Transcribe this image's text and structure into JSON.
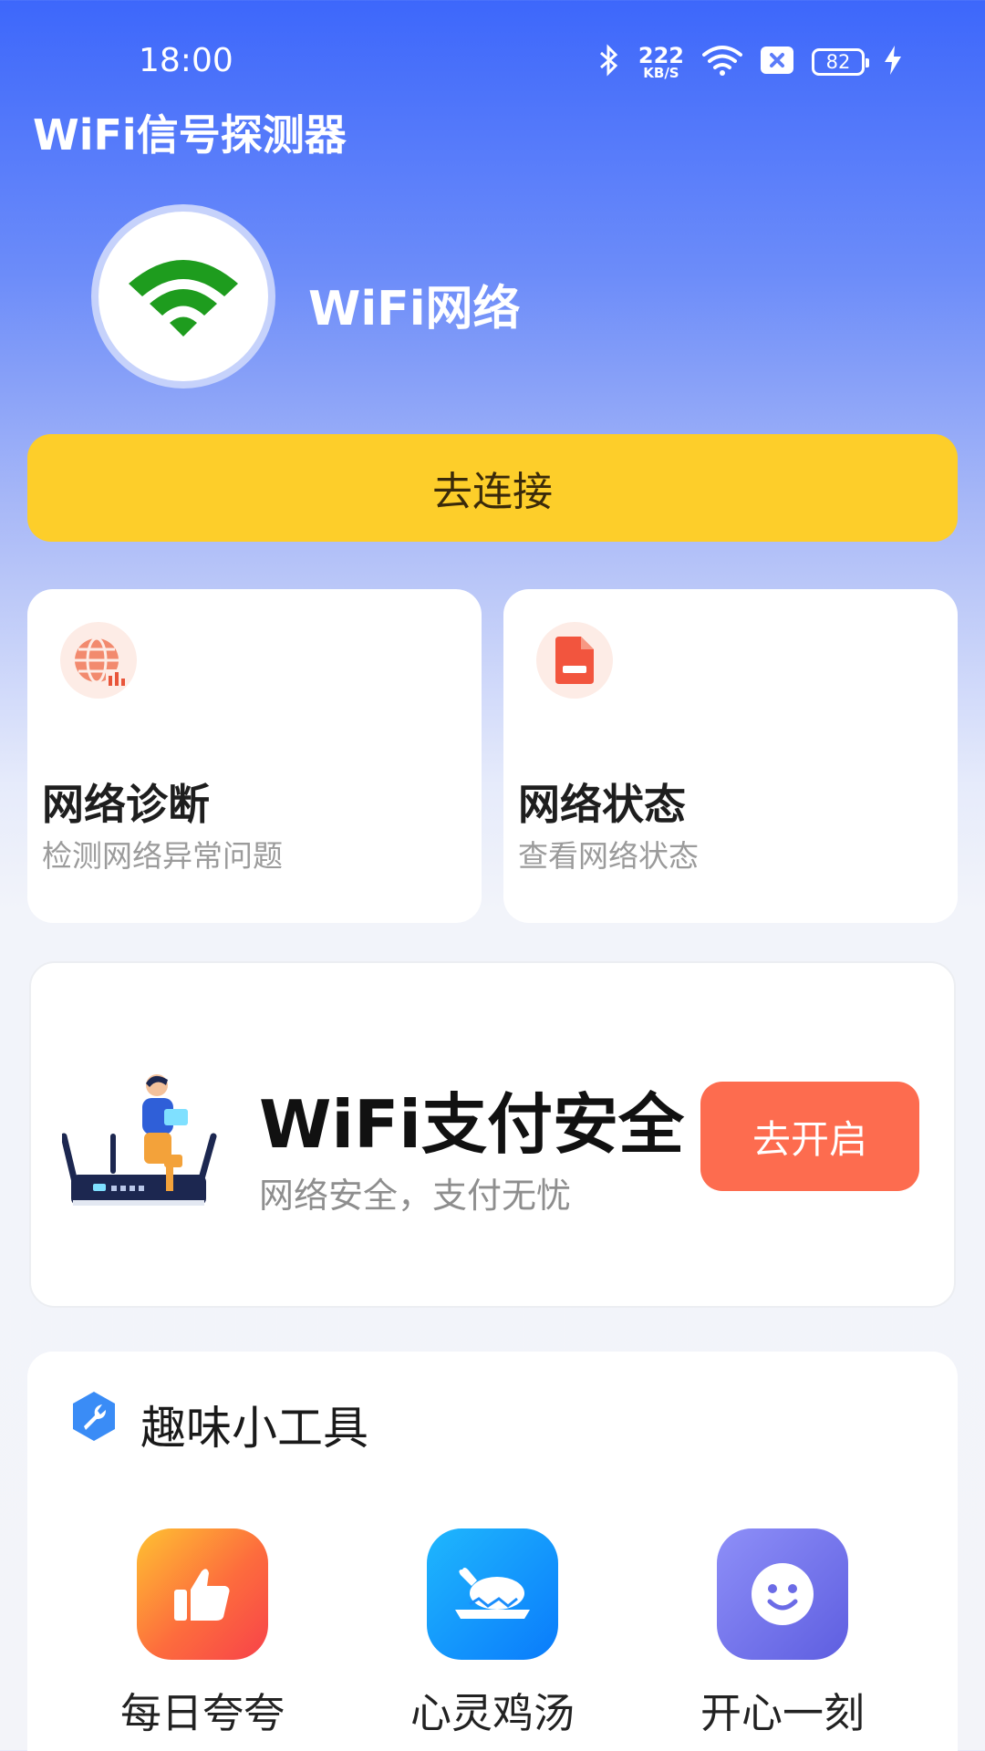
{
  "status_bar": {
    "time": "18:00",
    "net_speed": "222",
    "net_unit": "KB/S",
    "battery": "82",
    "icons": [
      "bluetooth-icon",
      "wifi-signal-icon",
      "sim-off-icon",
      "battery-icon",
      "charging-icon"
    ]
  },
  "app": {
    "title": "WiFi信号探测器"
  },
  "wifi": {
    "name": "WiFi网络",
    "icon": "wifi-icon",
    "icon_color": "#1e9c1e"
  },
  "connect": {
    "label": "去连接",
    "color": "#fdce2a"
  },
  "cards": [
    {
      "title": "网络诊断",
      "subtitle": "检测网络异常问题",
      "icon": "globe-chart-icon"
    },
    {
      "title": "网络状态",
      "subtitle": "查看网络状态",
      "icon": "document-icon"
    }
  ],
  "promo": {
    "title": "WiFi支付安全",
    "subtitle": "网络安全，支付无忧",
    "button": "去开启",
    "button_color": "#fd6c4f",
    "icon": "router-person-illustration"
  },
  "tools": {
    "title": "趣味小工具",
    "icon": "wrench-icon",
    "items": [
      {
        "label": "每日夸夸",
        "icon": "thumbs-up-icon"
      },
      {
        "label": "心灵鸡汤",
        "icon": "roast-chicken-icon"
      },
      {
        "label": "开心一刻",
        "icon": "smile-icon"
      }
    ]
  }
}
